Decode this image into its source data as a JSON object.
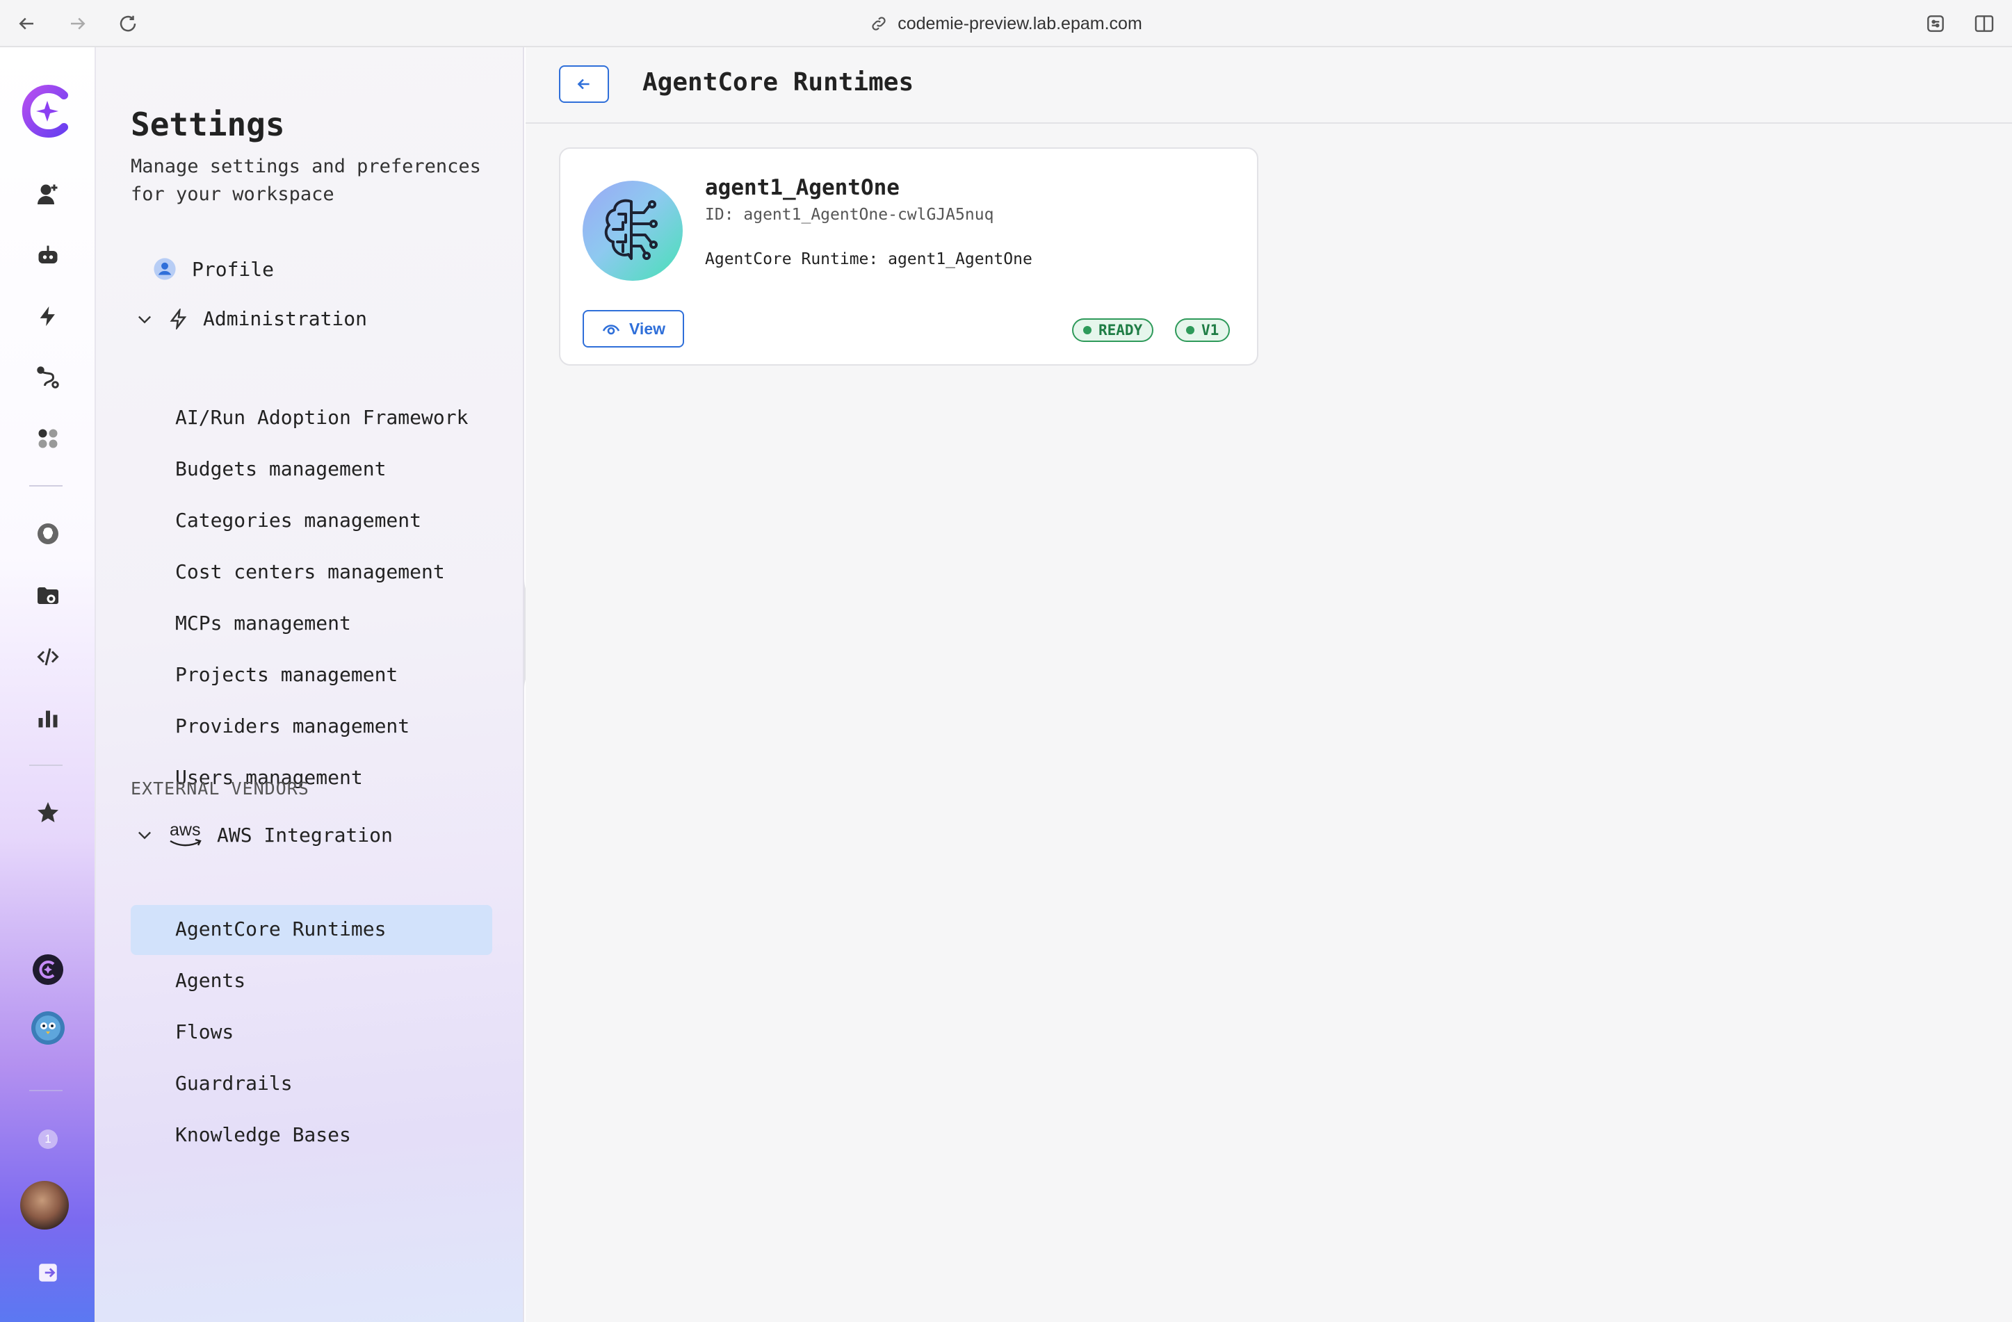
{
  "browser": {
    "url": "codemie-preview.lab.epam.com"
  },
  "sidebar": {
    "title": "Settings",
    "subtitle": "Manage settings and preferences for your workspace",
    "profile_label": "Profile",
    "administration": {
      "label": "Administration",
      "items": [
        {
          "label": "AI/Run Adoption Framework"
        },
        {
          "label": "Budgets management"
        },
        {
          "label": "Categories management"
        },
        {
          "label": "Cost centers management"
        },
        {
          "label": "MCPs management"
        },
        {
          "label": "Projects management"
        },
        {
          "label": "Providers management"
        },
        {
          "label": "Users management"
        }
      ]
    },
    "external_vendors_label": "EXTERNAL VENDORS",
    "aws": {
      "logo_text": "aws",
      "label": "AWS Integration",
      "items": [
        {
          "label": "AgentCore Runtimes",
          "active": true
        },
        {
          "label": "Agents"
        },
        {
          "label": "Flows"
        },
        {
          "label": "Guardrails"
        },
        {
          "label": "Knowledge Bases"
        }
      ]
    }
  },
  "rail": {
    "notification_count": "1",
    "icons": [
      "codemie-logo-icon",
      "assistant-add-icon",
      "robot-icon",
      "lightning-icon",
      "workflow-icon",
      "apps-icon",
      "brain-icon",
      "data-sources-icon",
      "code-icon",
      "analytics-icon",
      "star-icon",
      "codemie-badge-icon",
      "owl-avatar-icon",
      "notification-icon",
      "user-avatar",
      "logout-icon"
    ]
  },
  "main": {
    "title": "AgentCore Runtimes",
    "card": {
      "name": "agent1_AgentOne",
      "id_line": "ID: agent1_AgentOne-cwlGJA5nuq",
      "runtime_line": "AgentCore Runtime: agent1_AgentOne",
      "view_label": "View",
      "status_badge": "READY",
      "version_badge": "V1"
    }
  },
  "colors": {
    "accent": "#2f6fd9",
    "brand": "#8b3ff2",
    "ready": "#2e9a5a",
    "active_item_bg": "#d2e2fb"
  }
}
